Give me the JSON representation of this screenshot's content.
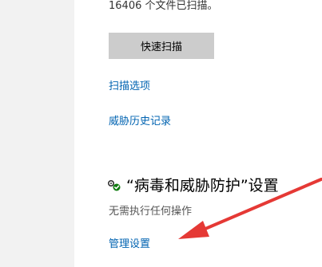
{
  "scan_status": {
    "files_scanned_text": "16406 个文件已扫描。"
  },
  "actions": {
    "quick_scan_label": "快速扫描",
    "scan_options_label": "扫描选项",
    "threat_history_label": "威胁历史记录"
  },
  "settings_section": {
    "icon": "gear-check-icon",
    "title": "“病毒和威胁防护”设置",
    "status_text": "无需执行任何操作",
    "manage_link_label": "管理设置"
  },
  "colors": {
    "link": "#0063b1",
    "button_bg": "#cccccc",
    "annotation_arrow": "#e53935",
    "check_green": "#107c10"
  }
}
